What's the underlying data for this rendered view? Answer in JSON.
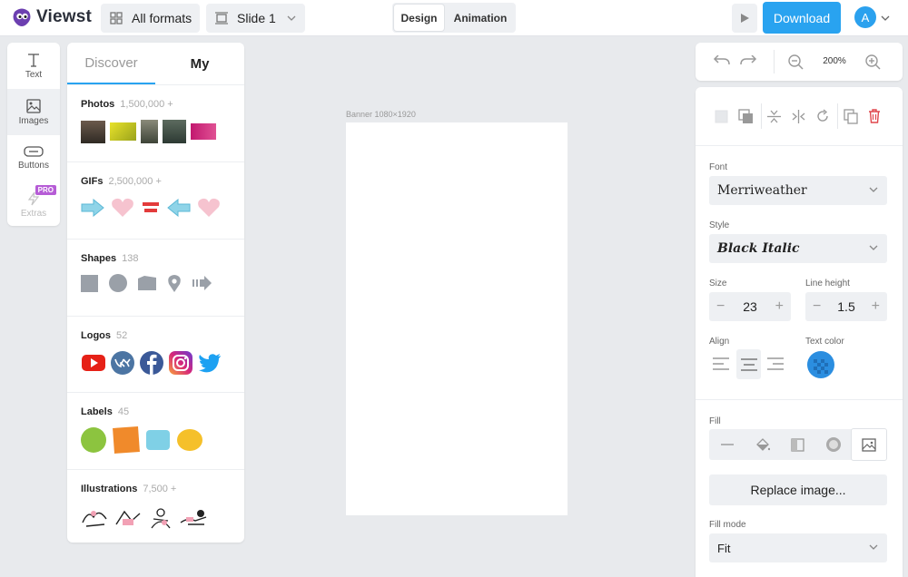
{
  "app": {
    "name": "Viewst",
    "brand_color": "#2ba1ee"
  },
  "toolbar": {
    "formats_label": "All formats",
    "slide_label": "Slide 1",
    "tabs": [
      {
        "label": "Design",
        "active": true
      },
      {
        "label": "Animation",
        "active": false
      }
    ],
    "download_label": "Download",
    "avatar_initial": "A"
  },
  "rail": {
    "items": [
      {
        "label": "Text",
        "icon": "text-icon"
      },
      {
        "label": "Images",
        "icon": "image-icon",
        "active": true
      },
      {
        "label": "Buttons",
        "icon": "button-icon"
      },
      {
        "label": "Extras",
        "icon": "bolt-icon",
        "badge": "PRO",
        "disabled": true
      }
    ]
  },
  "assets": {
    "tabs": [
      {
        "label": "Discover",
        "active": true
      },
      {
        "label": "My",
        "active": false
      }
    ],
    "sections": [
      {
        "title": "Photos",
        "count": "1,500,000 +"
      },
      {
        "title": "GIFs",
        "count": "2,500,000 +"
      },
      {
        "title": "Shapes",
        "count": "138"
      },
      {
        "title": "Logos",
        "count": "52"
      },
      {
        "title": "Labels",
        "count": "45"
      },
      {
        "title": "Illustrations",
        "count": "7,500 +"
      }
    ]
  },
  "canvas": {
    "label": "Banner 1080×1920"
  },
  "history": {
    "zoom": "200%"
  },
  "props": {
    "font_label": "Font",
    "font_value": "Merriweather",
    "style_label": "Style",
    "style_value": "Black Italic",
    "size_label": "Size",
    "size_value": "23",
    "line_height_label": "Line height",
    "line_height_value": "1.5",
    "align_label": "Align",
    "text_color_label": "Text color",
    "fill_label": "Fill",
    "replace_label": "Replace image...",
    "fill_mode_label": "Fill mode",
    "fill_mode_value": "Fit"
  }
}
